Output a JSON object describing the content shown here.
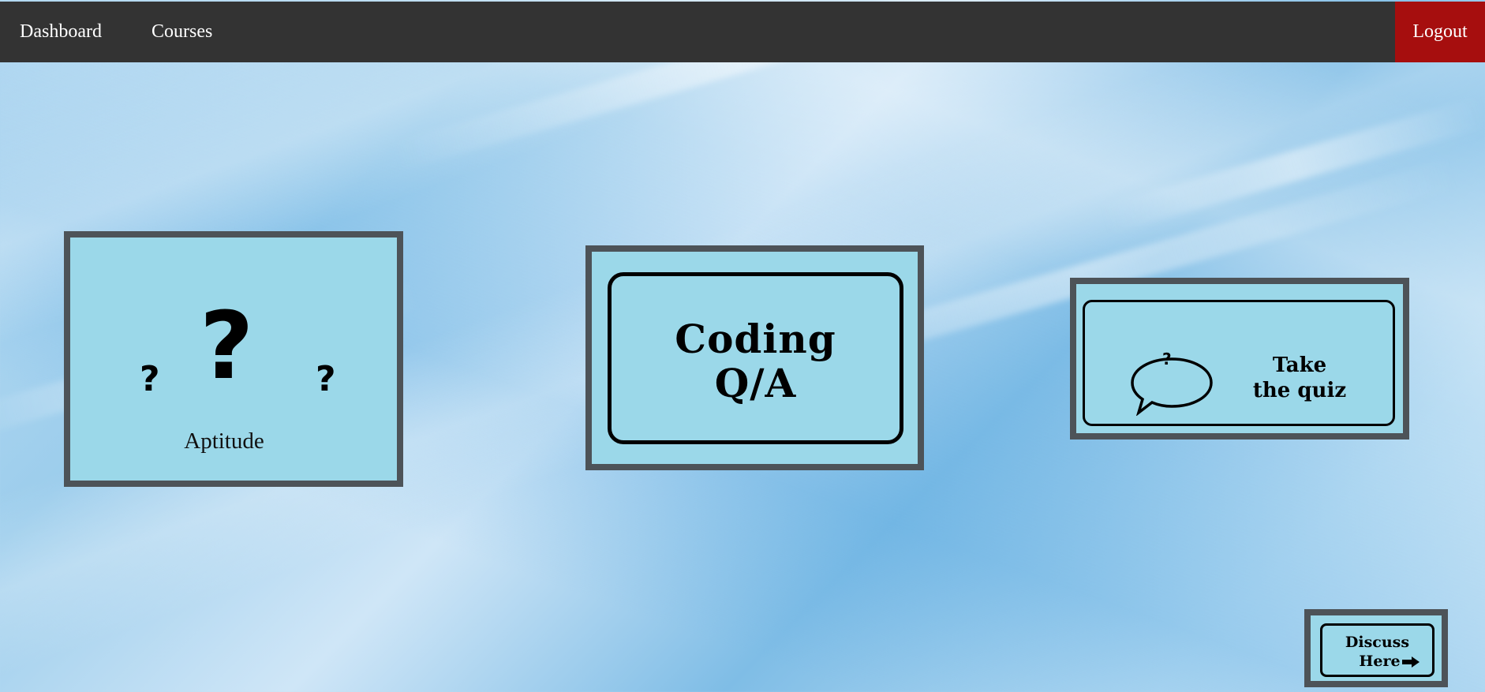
{
  "navbar": {
    "links": [
      {
        "label": "Dashboard"
      },
      {
        "label": "Courses"
      }
    ],
    "logout_label": "Logout",
    "logout_color": "#a60e0e",
    "background_color": "#333333"
  },
  "cards": {
    "aptitude": {
      "label": "Aptitude",
      "icon": "question-marks-icon",
      "big_mark": "?",
      "small_mark": "?"
    },
    "coding": {
      "line1": "Coding",
      "line2": "Q/A"
    },
    "quiz": {
      "bubble_mark": "?",
      "line1": "Take",
      "line2": "the quiz",
      "icon": "speech-bubble-icon"
    },
    "discuss": {
      "line1": "Discuss",
      "line2": "Here",
      "icon": "arrow-right-icon"
    }
  },
  "colors": {
    "card_background": "#9bd8e9",
    "card_border": "#4d5358"
  }
}
